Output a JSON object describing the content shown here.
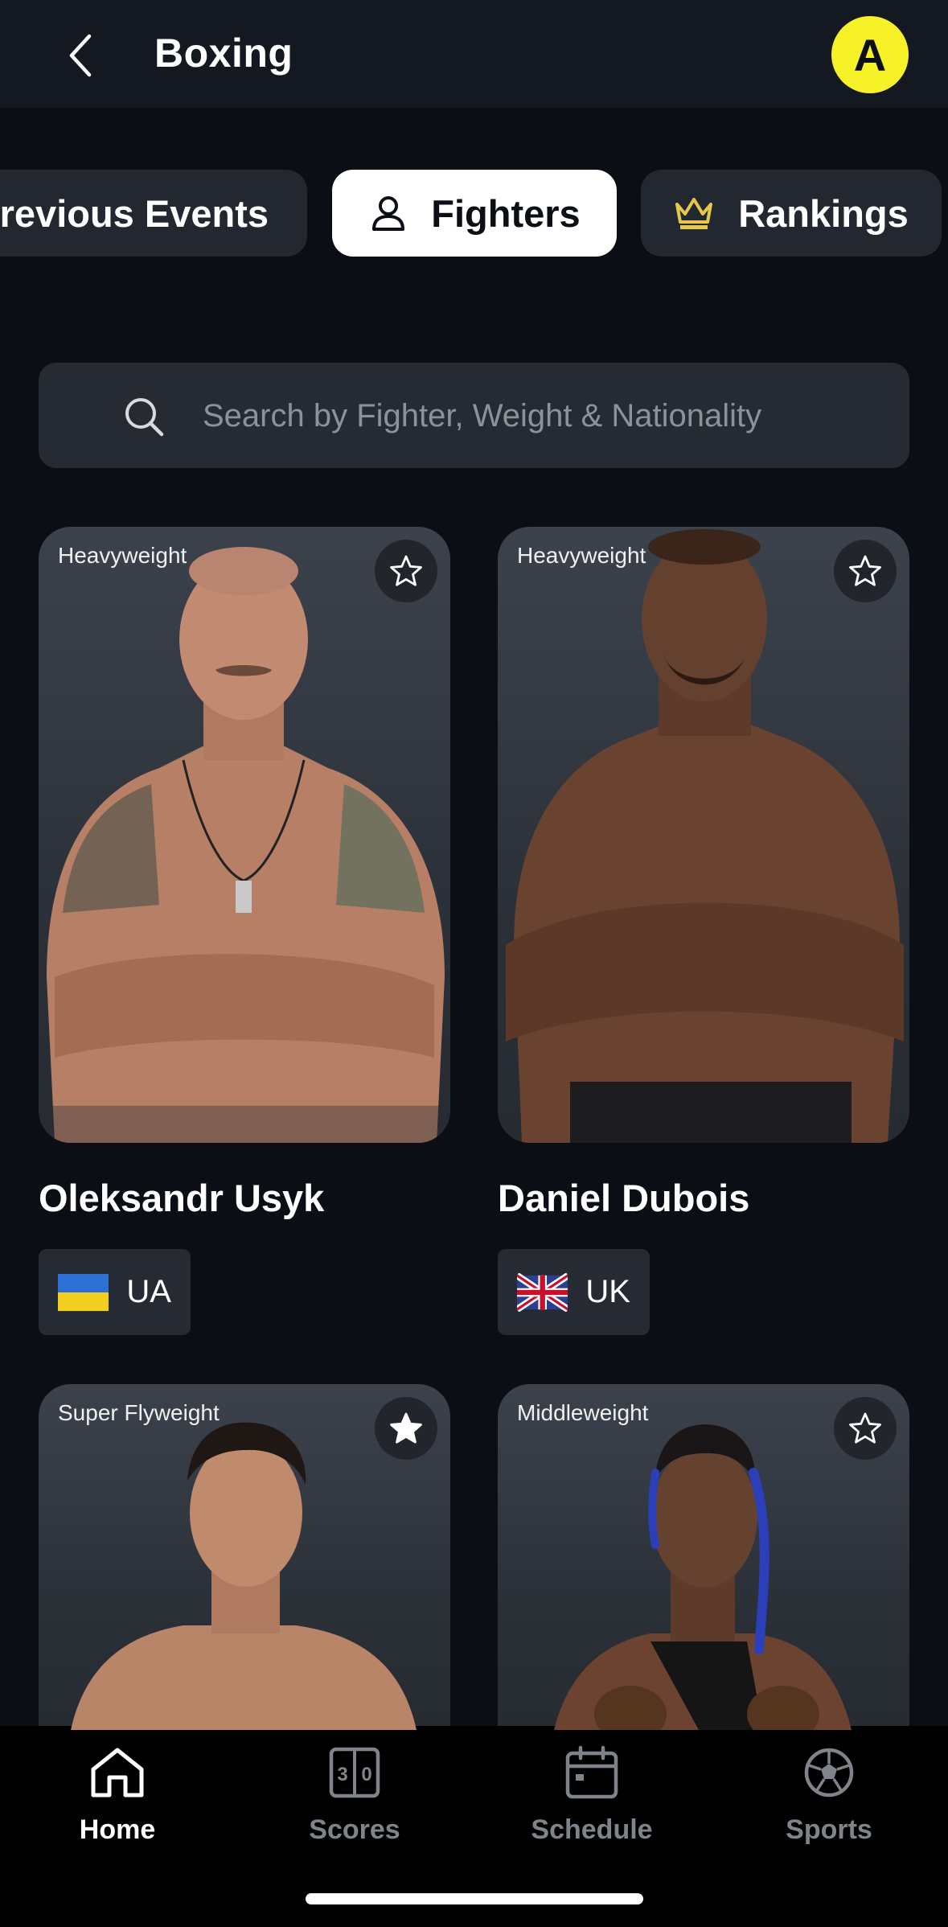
{
  "header": {
    "title": "Boxing",
    "avatar_letter": "A"
  },
  "tabs": [
    {
      "label": "Previous Events",
      "active": false
    },
    {
      "label": "Fighters",
      "active": true,
      "icon": "person-icon"
    },
    {
      "label": "Rankings",
      "active": false,
      "icon": "crown-icon"
    }
  ],
  "search": {
    "placeholder": "Search by Fighter, Weight & Nationality",
    "value": ""
  },
  "fighters": [
    {
      "name": "Oleksandr Usyk",
      "weight_class": "Heavyweight",
      "nationality": "UA",
      "favorited": false
    },
    {
      "name": "Daniel Dubois",
      "weight_class": "Heavyweight",
      "nationality": "UK",
      "favorited": false
    },
    {
      "name": "",
      "weight_class": "Super Flyweight",
      "nationality": "",
      "favorited": true
    },
    {
      "name": "",
      "weight_class": "Middleweight",
      "nationality": "",
      "favorited": false
    }
  ],
  "bottom_nav": [
    {
      "label": "Home",
      "icon": "home-icon",
      "active": true
    },
    {
      "label": "Scores",
      "icon": "scoreboard-icon",
      "active": false
    },
    {
      "label": "Schedule",
      "icon": "calendar-icon",
      "active": false
    },
    {
      "label": "Sports",
      "icon": "soccer-ball-icon",
      "active": false
    }
  ],
  "colors": {
    "background": "#0b0f15",
    "header": "#131821",
    "accent_yellow": "#f6f227",
    "crown_gold": "#e8c84a",
    "card": "#2f343c"
  }
}
